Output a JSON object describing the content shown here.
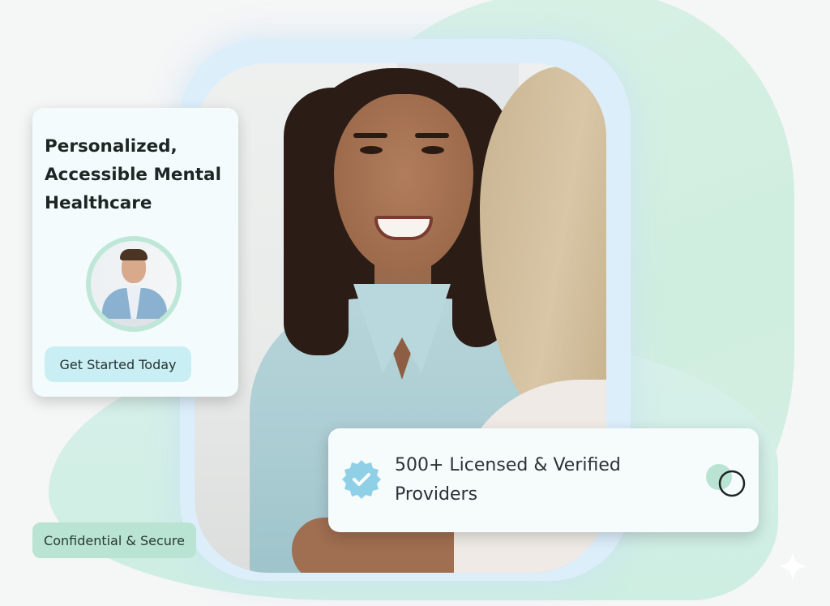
{
  "hero_card": {
    "title": "Personalized, Accessible Mental Healthcare",
    "cta_label": "Get Started Today"
  },
  "providers_card": {
    "text": "500+ Licensed & Verified Providers",
    "badge_icon": "verified-badge-icon",
    "toggle_icon": "radio-toggle-icon"
  },
  "security_pill": {
    "label": "Confidential & Secure"
  },
  "colors": {
    "mint": "#cfeedf",
    "halo": "#ddeefb",
    "button": "#c9eef3",
    "pill": "#b9e3d2",
    "badge": "#8fd0e6"
  }
}
